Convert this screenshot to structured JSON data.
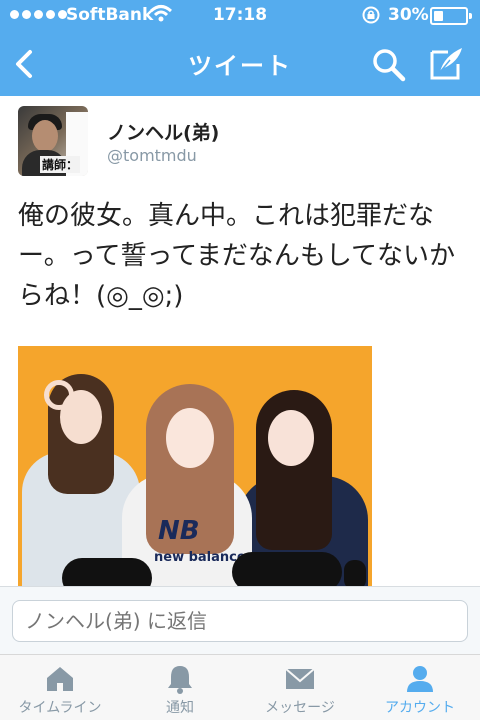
{
  "status_bar": {
    "carrier": "SoftBank",
    "time": "17:18",
    "battery": "30%",
    "battery_level": 0.3,
    "signal_dots": 5
  },
  "nav": {
    "title": "ツイート"
  },
  "tweet": {
    "author_name": "ノンヘル(弟)",
    "author_handle": "@tomtmdu",
    "avatar_sign_text": "講師：",
    "text": "俺の彼女。真ん中。これは犯罪だなー。って誓ってまだなんもしてないからね！(◎_◎;)",
    "photo_caption_text": "NB",
    "photo_caption_sub": "new balance"
  },
  "reply": {
    "placeholder": "ノンヘル(弟) に返信"
  },
  "tabs": [
    {
      "label": "タイムライン",
      "icon": "home-icon",
      "active": false
    },
    {
      "label": "通知",
      "icon": "bell-icon",
      "active": false
    },
    {
      "label": "メッセージ",
      "icon": "envelope-icon",
      "active": false
    },
    {
      "label": "アカウント",
      "icon": "person-icon",
      "active": true
    }
  ],
  "colors": {
    "brand": "#55acee",
    "inactive_tab": "#8899a6"
  }
}
